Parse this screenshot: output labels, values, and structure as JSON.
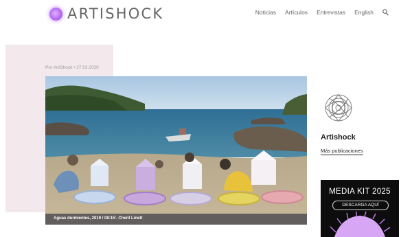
{
  "header": {
    "brand": "ARTISHOCK",
    "nav": [
      "Noticias",
      "Artículos",
      "Entrevistas",
      "English"
    ],
    "accent_color": "#b46df0"
  },
  "article": {
    "byline": "Por ArtiShock • 27.03.2020",
    "hero_caption": "Aguas durmientes, 2019 / 08:15’. Cheril Linett"
  },
  "author": {
    "name": "Artishock",
    "more_link": "Más publicaciones"
  },
  "ad": {
    "title": "MEDIA KIT 2025",
    "button_label": "DESCARGA AQUÍ"
  }
}
